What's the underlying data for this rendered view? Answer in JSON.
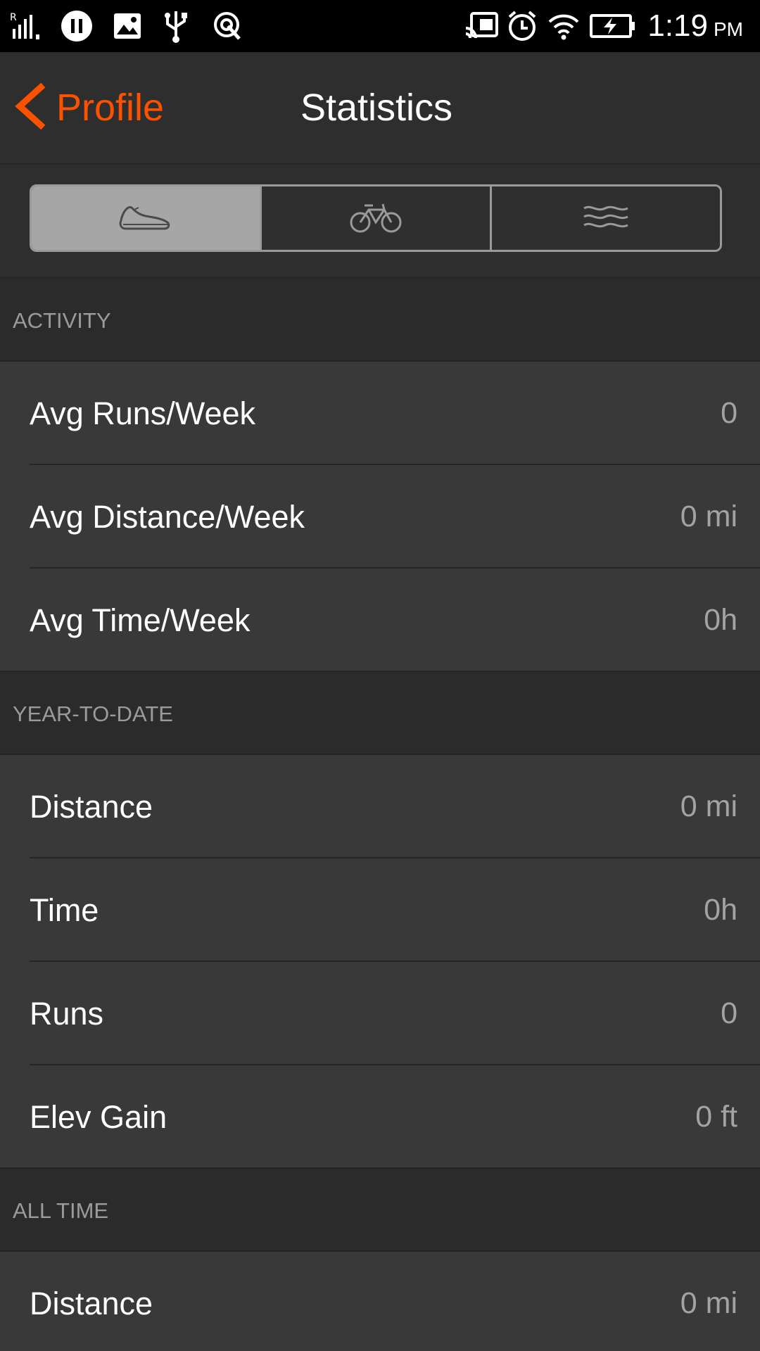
{
  "status_bar": {
    "time": "1:19",
    "ampm": "PM",
    "icons": [
      "signal-icon",
      "pause-icon",
      "image-icon",
      "usb-icon",
      "touch-icon",
      "cast-icon",
      "alarm-icon",
      "wifi-icon",
      "battery-charging-icon"
    ]
  },
  "nav": {
    "back_label": "Profile",
    "title": "Statistics",
    "accent_color": "#fc5200"
  },
  "segments": [
    {
      "icon": "run-shoe-icon",
      "selected": true
    },
    {
      "icon": "bike-icon",
      "selected": false
    },
    {
      "icon": "swim-icon",
      "selected": false
    }
  ],
  "sections": [
    {
      "title": "ACTIVITY",
      "rows": [
        {
          "label": "Avg Runs/Week",
          "value": "0"
        },
        {
          "label": "Avg Distance/Week",
          "value": "0 mi"
        },
        {
          "label": "Avg Time/Week",
          "value": "0h"
        }
      ]
    },
    {
      "title": "YEAR-TO-DATE",
      "rows": [
        {
          "label": "Distance",
          "value": "0 mi"
        },
        {
          "label": "Time",
          "value": "0h"
        },
        {
          "label": "Runs",
          "value": "0"
        },
        {
          "label": "Elev Gain",
          "value": "0 ft"
        }
      ]
    },
    {
      "title": "ALL TIME",
      "rows": [
        {
          "label": "Distance",
          "value": "0 mi"
        }
      ]
    }
  ]
}
